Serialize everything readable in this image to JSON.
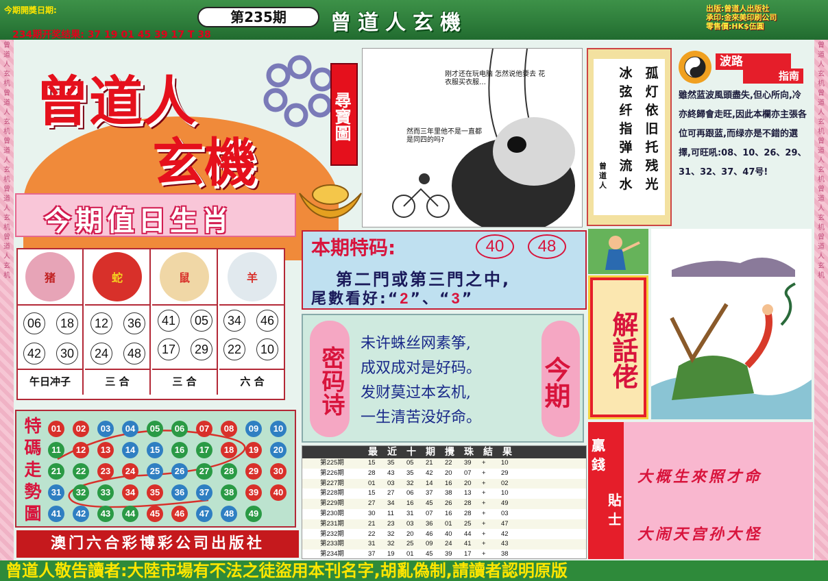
{
  "header": {
    "open_date_label": "今期開獎日期:",
    "issue": "第235期",
    "previous_result": "234期开奖结果: 37 19 01 45 39 17 T 38",
    "title": "曾道人玄機",
    "publisher_lines": [
      "出版:曾道人出版社",
      "承印:金來美印刷公司",
      "零售價:HK$伍圓"
    ]
  },
  "border": {
    "side_text": "曾道人玄机曾道人玄机曾道人玄机曾道人玄机曾道人玄机"
  },
  "logo": {
    "main": "曾道人",
    "sub": "玄機",
    "badge": "尋寶圖"
  },
  "zodiac": {
    "title": "今期值日生肖",
    "animals": [
      {
        "name": "猪",
        "color": "#e7a4b7",
        "numbers": [
          "06",
          "18",
          "42",
          "30"
        ],
        "label": "午日冲子"
      },
      {
        "name": "蛇",
        "color": "#d8302a",
        "numbers": [
          "12",
          "36",
          "24",
          "48"
        ],
        "label": "三 合"
      },
      {
        "name": "鼠",
        "color": "#f0d7a6",
        "numbers": [
          "41",
          "05",
          "17",
          "29"
        ],
        "label": "三 合"
      },
      {
        "name": "羊",
        "color": "#e1e9ee",
        "numbers": [
          "34",
          "46",
          "22",
          "10"
        ],
        "label": "六 合"
      }
    ]
  },
  "trend": {
    "label": "特碼走勢圖",
    "colors": {
      "red": "#d8302a",
      "blue": "#2f7fc2",
      "green": "#2a9a45"
    },
    "rows": [
      [
        [
          "01",
          "red"
        ],
        [
          "02",
          "red"
        ],
        [
          "03",
          "blue"
        ],
        [
          "04",
          "blue"
        ],
        [
          "05",
          "green"
        ],
        [
          "06",
          "green"
        ],
        [
          "07",
          "red"
        ],
        [
          "08",
          "red"
        ],
        [
          "09",
          "blue"
        ],
        [
          "10",
          "blue"
        ]
      ],
      [
        [
          "11",
          "green"
        ],
        [
          "12",
          "red"
        ],
        [
          "13",
          "red"
        ],
        [
          "14",
          "blue"
        ],
        [
          "15",
          "blue"
        ],
        [
          "16",
          "green"
        ],
        [
          "17",
          "green"
        ],
        [
          "18",
          "red"
        ],
        [
          "19",
          "red"
        ],
        [
          "20",
          "blue"
        ]
      ],
      [
        [
          "21",
          "green"
        ],
        [
          "22",
          "green"
        ],
        [
          "23",
          "red"
        ],
        [
          "24",
          "red"
        ],
        [
          "25",
          "blue"
        ],
        [
          "26",
          "blue"
        ],
        [
          "27",
          "green"
        ],
        [
          "28",
          "green"
        ],
        [
          "29",
          "red"
        ],
        [
          "30",
          "red"
        ]
      ],
      [
        [
          "31",
          "blue"
        ],
        [
          "32",
          "green"
        ],
        [
          "33",
          "green"
        ],
        [
          "34",
          "red"
        ],
        [
          "35",
          "red"
        ],
        [
          "36",
          "blue"
        ],
        [
          "37",
          "blue"
        ],
        [
          "38",
          "green"
        ],
        [
          "39",
          "red"
        ],
        [
          "40",
          "red"
        ]
      ],
      [
        [
          "41",
          "blue"
        ],
        [
          "42",
          "blue"
        ],
        [
          "43",
          "green"
        ],
        [
          "44",
          "green"
        ],
        [
          "45",
          "red"
        ],
        [
          "46",
          "red"
        ],
        [
          "47",
          "blue"
        ],
        [
          "48",
          "blue"
        ],
        [
          "49",
          "green"
        ]
      ]
    ]
  },
  "bottom_publisher": "澳门六合彩博彩公司出版社",
  "comic": {
    "bubble_1": "刚才还在玩电脑 怎然说他要去 花衣服买衣服…",
    "bubble_2": "然而三年里他不是一直都是同四的吗?"
  },
  "scroll": {
    "col_right": "孤灯依旧托残光",
    "col_left": "冰弦纤指弹流水",
    "signature": "曾道人"
  },
  "wave_guide": {
    "title_1": "波路",
    "title_2": "指南",
    "text": "雖然蓝波風頭盡失,但心所向,冷亦終歸會走旺,因此本欄亦主張各位可再跟蓝,而绿亦是不錯的選擇,可旺吼:08、10、26、29、31、32、37、47号!"
  },
  "special": {
    "label": "本期特码:",
    "numbers": [
      "40",
      "48"
    ],
    "line_2": "第二門或第三門之中,",
    "line_3_prefix": "尾數看好:",
    "tails": [
      "2",
      "3"
    ]
  },
  "poem": {
    "left_label": "密码诗",
    "right_label": "今期",
    "lines": [
      "未许蛛丝网素筝,",
      "成双成对是好码。",
      "发财莫过本玄机,",
      "一生清苦没好命。"
    ]
  },
  "recent": {
    "title": "最近十期攪珠結果",
    "rows": [
      [
        "第225期",
        "15",
        "35",
        "05",
        "21",
        "22",
        "39",
        "+",
        "10"
      ],
      [
        "第226期",
        "28",
        "43",
        "35",
        "42",
        "20",
        "07",
        "+",
        "29"
      ],
      [
        "第227期",
        "01",
        "03",
        "32",
        "14",
        "16",
        "20",
        "+",
        "02"
      ],
      [
        "第228期",
        "15",
        "27",
        "06",
        "37",
        "38",
        "13",
        "+",
        "10"
      ],
      [
        "第229期",
        "27",
        "34",
        "16",
        "45",
        "26",
        "28",
        "+",
        "49"
      ],
      [
        "第230期",
        "30",
        "11",
        "31",
        "07",
        "16",
        "28",
        "+",
        "03"
      ],
      [
        "第231期",
        "21",
        "23",
        "03",
        "36",
        "01",
        "25",
        "+",
        "47"
      ],
      [
        "第232期",
        "22",
        "32",
        "20",
        "46",
        "40",
        "44",
        "+",
        "42"
      ],
      [
        "第233期",
        "31",
        "32",
        "25",
        "09",
        "24",
        "41",
        "+",
        "43"
      ],
      [
        "第234期",
        "37",
        "19",
        "01",
        "45",
        "39",
        "17",
        "+",
        "38"
      ]
    ]
  },
  "riddle": {
    "label": "解話佬"
  },
  "tips": {
    "label_left": "贏錢",
    "label_right": "貼士",
    "tip_1": "大概生來照才命",
    "tip_2": "大闹天宫孙大怪"
  },
  "footer": "曾道人敬告讀者:大陸市場有不法之徒盜用本刊名字,胡亂偽制,請讀者認明原版"
}
